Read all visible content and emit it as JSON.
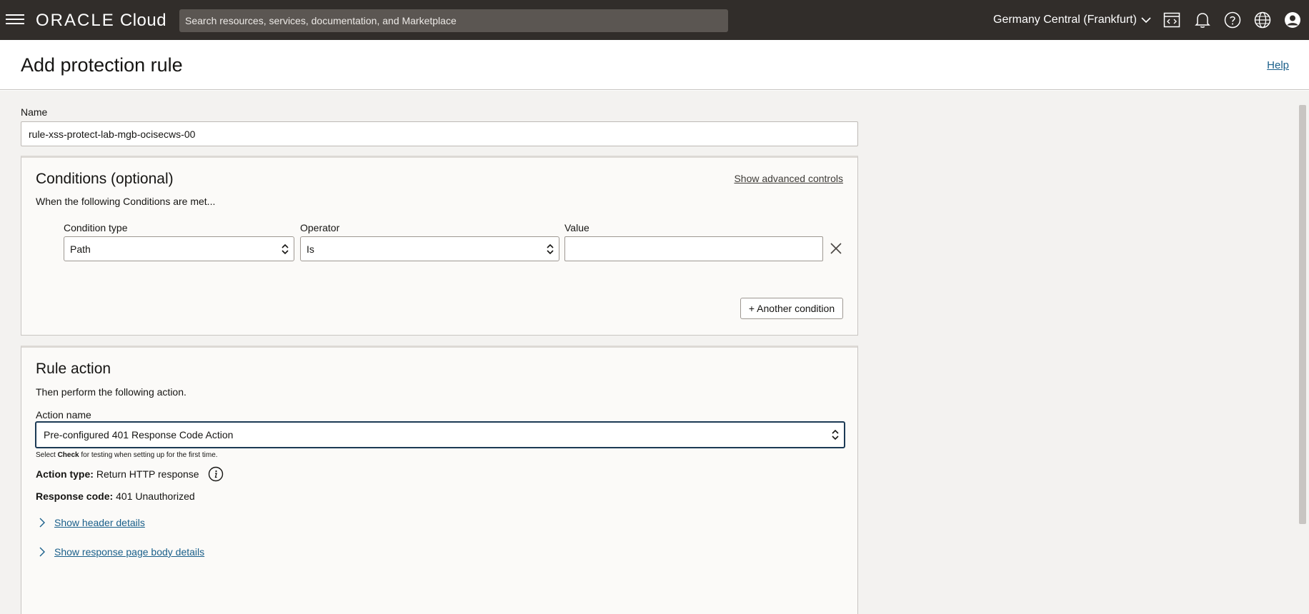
{
  "nav": {
    "brand": "ORACLE",
    "product": "Cloud",
    "search_placeholder": "Search resources, services, documentation, and Marketplace",
    "region": "Germany Central (Frankfurt)"
  },
  "header": {
    "title": "Add protection rule",
    "help_label": "Help"
  },
  "form": {
    "name_label": "Name",
    "name_value": "rule-xss-protect-lab-mgb-ocisecws-00"
  },
  "conditions": {
    "title": "Conditions (optional)",
    "advanced_label": "Show advanced controls",
    "subtitle": "When the following Conditions are met...",
    "condition_type_label": "Condition type",
    "operator_label": "Operator",
    "value_label": "Value",
    "condition_type_value": "Path",
    "operator_value": "Is",
    "value_value": "",
    "add_label": "+ Another condition"
  },
  "rule_action": {
    "title": "Rule action",
    "subtitle": "Then perform the following action.",
    "action_name_label": "Action name",
    "action_name_value": "Pre-configured 401 Response Code Action",
    "hint_prefix": "Select ",
    "hint_bold": "Check",
    "hint_suffix": " for testing when setting up for the first time.",
    "action_type_key": "Action type:",
    "action_type_value": "Return HTTP response",
    "response_code_key": "Response code:",
    "response_code_value": "401 Unauthorized",
    "header_details_label": "Show header details",
    "body_details_label": "Show response page body details"
  },
  "colors": {
    "topbar": "#312d2a",
    "link": "#1a5f8a",
    "focus": "#1c3a55"
  },
  "icons": [
    "menu-icon",
    "code-editor-icon",
    "bell-icon",
    "help-icon",
    "globe-icon",
    "profile-icon",
    "chevron-down-icon",
    "close-icon",
    "info-icon",
    "chevron-right-icon"
  ]
}
